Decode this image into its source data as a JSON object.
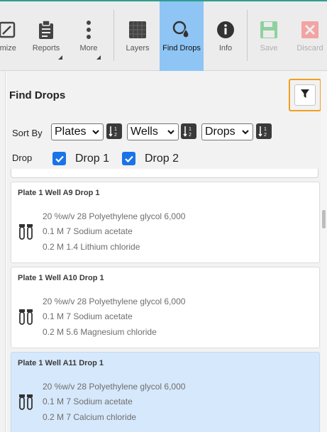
{
  "toolbar": {
    "items": [
      {
        "label": "imize",
        "icon": "optimize-icon"
      },
      {
        "label": "Reports",
        "icon": "clipboard-icon"
      },
      {
        "label": "More",
        "icon": "more-vertical-icon"
      },
      {
        "label": "Layers",
        "icon": "layers-icon"
      },
      {
        "label": "Find Drops",
        "icon": "find-drops-icon"
      },
      {
        "label": "Info",
        "icon": "info-icon"
      },
      {
        "label": "Save",
        "icon": "save-icon"
      },
      {
        "label": "Discard",
        "icon": "discard-icon"
      }
    ],
    "active_color": "#8ec5f5",
    "save_color": "#8fd19e",
    "discard_color": "#f3a3a3"
  },
  "panel": {
    "title": "Find Drops",
    "filter_icon": "funnel-icon",
    "filter_highlight_color": "#f0a020"
  },
  "sort": {
    "label": "Sort By",
    "selects": [
      "Plates",
      "Wells",
      "Drops"
    ]
  },
  "drop_filter": {
    "label": "Drop",
    "options": [
      {
        "label": "Drop 1",
        "checked": true
      },
      {
        "label": "Drop 2",
        "checked": true
      }
    ],
    "check_color": "#1a73e8"
  },
  "drops": [
    {
      "title": "Plate 1 Well A9 Drop 1",
      "lines": [
        "20 %w/v 28 Polyethylene glycol 6,000",
        "0.1 M 7 Sodium acetate",
        "0.2 M 1.4 Lithium chloride"
      ],
      "selected": false
    },
    {
      "title": "Plate 1 Well A10 Drop 1",
      "lines": [
        "20 %w/v 28 Polyethylene glycol 6,000",
        "0.1 M 7 Sodium acetate",
        "0.2 M 5.6 Magnesium chloride"
      ],
      "selected": false
    },
    {
      "title": "Plate 1 Well A11 Drop 1",
      "lines": [
        "20 %w/v 28 Polyethylene glycol 6,000",
        "0.1 M 7 Sodium acetate",
        "0.2 M 7 Calcium chloride"
      ],
      "selected": true
    }
  ],
  "selected_color": "#d6e8fb"
}
